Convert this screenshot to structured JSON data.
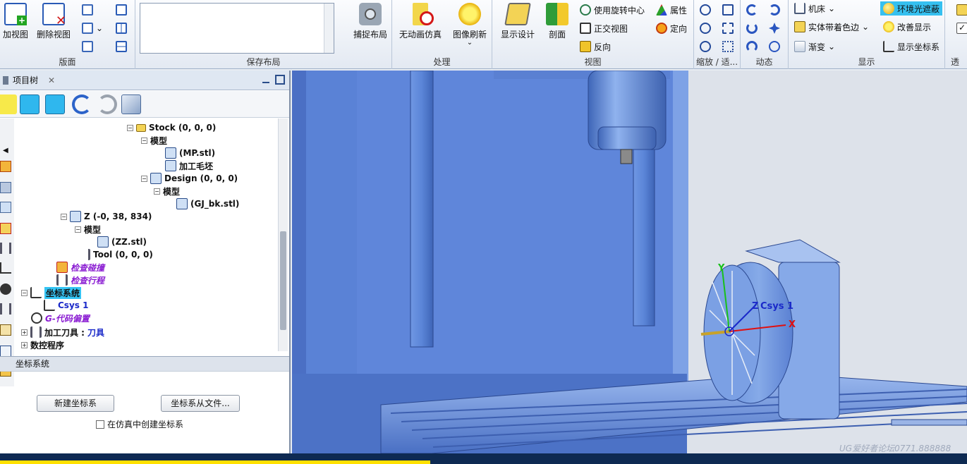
{
  "ribbon": {
    "groups": {
      "layout": {
        "label": "版面",
        "add_view": "加视图",
        "delete_view": "删除视图"
      },
      "save_layout": {
        "label": "保存布局",
        "capture_layout": "捕捉布局"
      },
      "process": {
        "label": "处理",
        "no_animation": "无动画仿真",
        "image_refresh": "图像刷新"
      },
      "view": {
        "label": "视图",
        "display_settings": "显示设计",
        "section": "剖面",
        "use_rotation_center": "使用旋转中心",
        "ortho_view": "正交视图",
        "reverse": "反向",
        "properties": "属性",
        "orient": "定向"
      },
      "zoom": {
        "label": "缩放 / 适..."
      },
      "dynamic": {
        "label": "动态"
      },
      "display": {
        "label": "显示",
        "machine": "机床",
        "solid_color_edges": "实体带着色边",
        "gradient": "渐变",
        "ambient_occlusion": "环境光遮蔽",
        "improve_display": "改善显示",
        "show_csys": "显示坐标系"
      },
      "extra": {
        "label": "透"
      }
    }
  },
  "panel": {
    "title": "项目树",
    "tree": {
      "stock": "Stock (0, 0, 0)",
      "model1": "模型",
      "mp": "(MP.stl)",
      "blank": "加工毛坯",
      "design": "Design (0, 0, 0)",
      "model2": "模型",
      "gj": "(GJ_bk.stl)",
      "z": "Z (-0, 38, 834)",
      "model3": "模型",
      "zz": "(ZZ.stl)",
      "tool": "Tool (0, 0, 0)",
      "check_collision": "检查碰撞",
      "check_travel": "检查行程",
      "csys": "坐标系统",
      "csys1": "Csys 1",
      "gcode_offset": "G-代码偏置",
      "cutting_tool_label": "加工刀具 : ",
      "cutting_tool_value": "刀具",
      "nc_program": "数控程序"
    },
    "section_title": "坐标系统",
    "new_csys_button": "新建坐标系",
    "csys_from_file_button": "坐标系从文件...",
    "create_in_sim_label": "在仿真中创建坐标系"
  },
  "viewport": {
    "axis_x": "X",
    "axis_y": "Y",
    "axis_z": "Z",
    "csys_name": "Csys 1",
    "watermark": "UG爱好者论坛0771.888888"
  },
  "colors": {
    "highlight": "#34c4f4",
    "machine_blue": "#5b85d8",
    "x_axis": "#e01010",
    "y_axis": "#18c01a",
    "z_axis": "#1a29c9"
  }
}
